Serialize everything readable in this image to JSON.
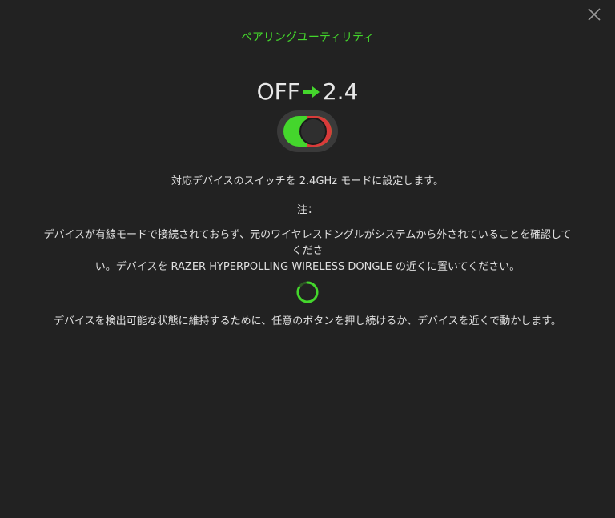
{
  "dialog": {
    "title": "ペアリングユーティリティ",
    "mode_from": "OFF",
    "mode_to": "2.4",
    "description": "対応デバイスのスイッチを 2.4GHz モードに設定します。",
    "note_label": "注：",
    "note_line1": "デバイスが有線モードで接続されておらず、元のワイヤレスドングルがシステムから外されていることを確認してくださ",
    "note_line2": "い。デバイスを RAZER HYPERPOLLING WIRELESS DONGLE の近くに置いてください。",
    "bottom_instruction": "デバイスを検出可能な状態に維持するために、任意のボタンを押し続けるか、デバイスを近くで動かします。"
  },
  "icons": {
    "close": "close-icon",
    "arrow": "arrow-right-icon",
    "spinner": "loading-spinner-icon"
  },
  "colors": {
    "background": "#222222",
    "accent_green": "#44d62c",
    "toggle_red": "#d93a3a",
    "text": "#e0e0e0"
  }
}
